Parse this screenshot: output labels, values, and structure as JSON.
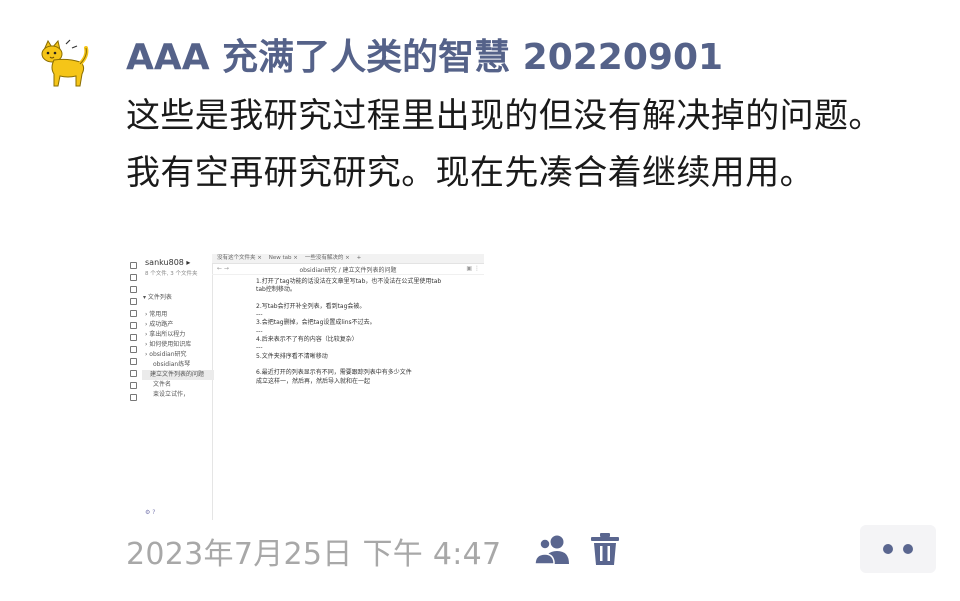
{
  "post": {
    "author": "AAA 充满了人类的智慧 20220901",
    "text": "这些是我研究过程里出现的但没有解决掉的问题。我有空再研究研究。现在先凑合着继续用用。",
    "timestamp": "2023年7月25日 下午 4:47"
  },
  "colors": {
    "author": "#556289",
    "timestamp": "#a8a8a8",
    "icons": "#5a668f",
    "more_bg": "#f4f4f6"
  },
  "icons": {
    "avatar": "yellow-cat-avatar",
    "visibility": "people-icon",
    "delete": "trash-icon",
    "more": "more-dots-icon"
  },
  "screenshot": {
    "vault_name": "sanku808 ▸",
    "files_info": "8 个文件, 3 个文件夹",
    "section": "▾ 文件列表",
    "tree": [
      "› 常用用",
      "› 成功路产",
      "› 拿出所以程力",
      "› 如何使用知识库",
      "› obsidian研究",
      "obsidian练琴",
      "建立文件列表的问题",
      "文件名",
      "束设立试作，"
    ],
    "tabs": [
      "没有这个文件夹 ×",
      "New tab ×",
      "一些没有解决的 ×",
      "+"
    ],
    "doc_title": "obsidian研究 / 建立文件列表的问题",
    "lines": [
      "1.打开了tag功能的话没法在文章里写tab，也不没法在公式里使用tab",
      "tab控制移动。",
      "",
      "2.写tab会打开补全列表，看到tag会被。",
      "---",
      "3.会把tag删掉，会把tag设置成lins不过去。",
      "---",
      "4.后来表示不了有的内容（比较复杂）",
      "---",
      "5.文件夹排序看不清晰移动",
      "",
      "6.最近打开的列表显示有不同，需要跟踪列表中有多少文件",
      "成立这样一，然后再，然后导入就和在一起"
    ],
    "footer": "⚙ ?"
  }
}
